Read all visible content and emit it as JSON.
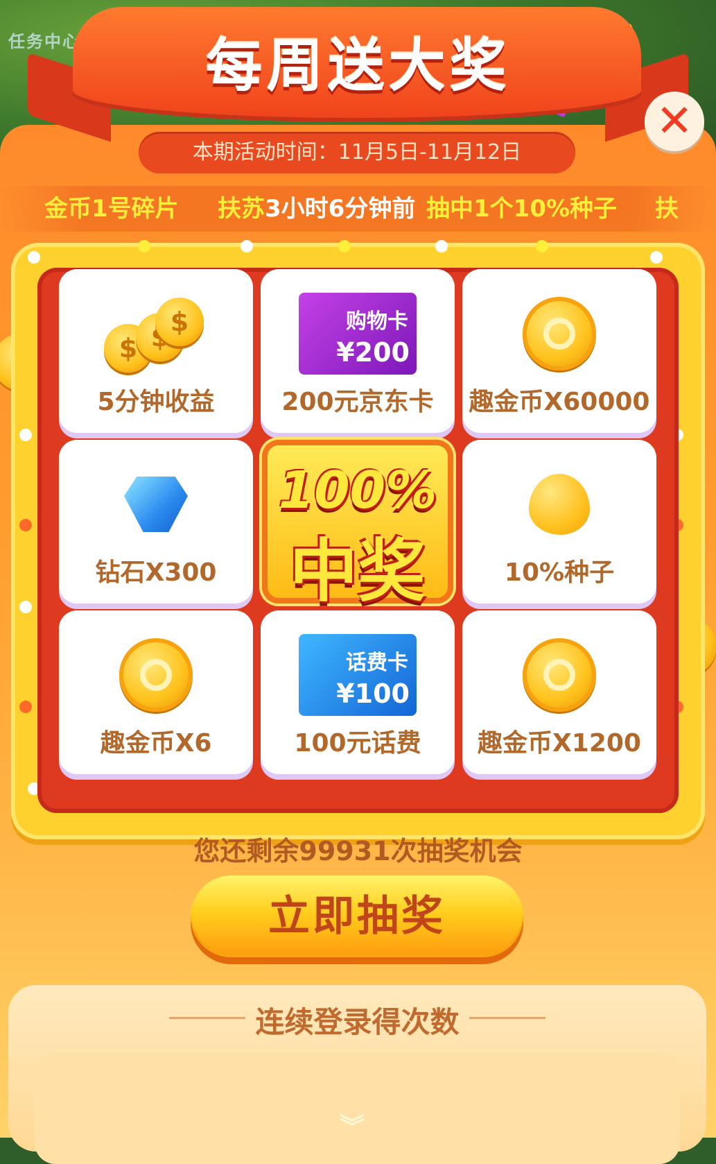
{
  "background": {
    "corner_label": "任务中心"
  },
  "banner": {
    "title": "每周送大奖",
    "period": "本期活动时间：11月5日-11月12日"
  },
  "close_button": {
    "icon": "close-icon",
    "symbol": "✕"
  },
  "marquee": {
    "item1": "金币1号碎片",
    "user": "扶苏",
    "time": "3小时6分钟前",
    "result": "抽中1个10%种子",
    "next": "扶"
  },
  "prizes": [
    {
      "label": "5分钟收益",
      "icon": "coin-stack-icon"
    },
    {
      "label": "200元京东卡",
      "icon": "shopping-card-icon",
      "card_title": "购物卡",
      "card_amount": "¥200"
    },
    {
      "label": "趣金币X60000",
      "icon": "qu-coin-icon"
    },
    {
      "label": "钻石X300",
      "icon": "diamond-icon"
    },
    {
      "label": "10%种子",
      "icon": "seed-icon"
    },
    {
      "label": "趣金币X6",
      "icon": "qu-coin-icon"
    },
    {
      "label": "100元话费",
      "icon": "phone-card-icon",
      "card_title": "话费卡",
      "card_amount": "¥100"
    },
    {
      "label": "趣金币X1200",
      "icon": "qu-coin-icon"
    }
  ],
  "center": {
    "top": "100%",
    "bottom": "中奖"
  },
  "chances_text": "您还剩余99931次抽奖机会",
  "draw_button_label": "立即抽奖",
  "login": {
    "title": "连续登录得次数"
  },
  "colors": {
    "primary_orange": "#ff8a2b",
    "banner_red": "#f0431c",
    "board_yellow": "#ffd12e",
    "board_red": "#de3a1f",
    "label_brown": "#b1682a",
    "marquee_yellow": "#ffef3a"
  }
}
